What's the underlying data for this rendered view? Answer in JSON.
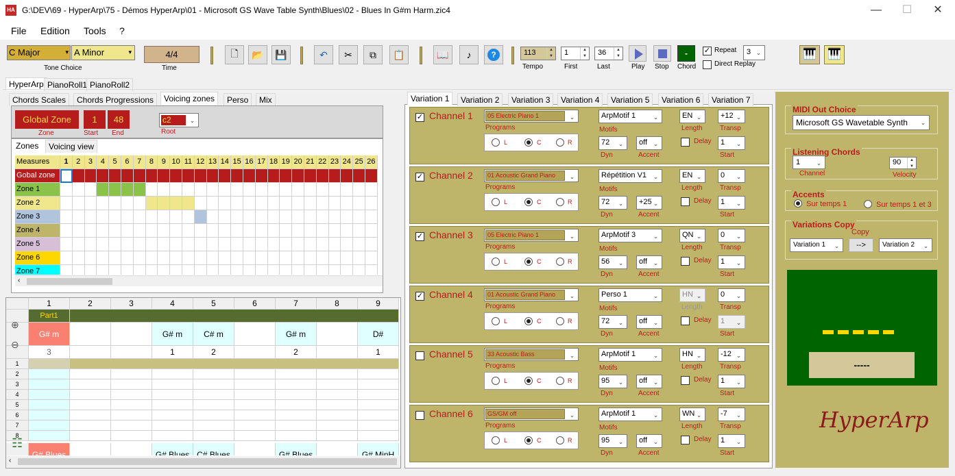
{
  "title": "G:\\DEV\\69 - HyperArp\\75 - Démos HyperArp\\01 - Microsoft GS Wave Table Synth\\Blues\\02 - Blues In G#m Harm.zic4",
  "app_icon_text": "HA",
  "window": {
    "minimize": "—",
    "maximize": "☐",
    "close": "✕"
  },
  "menu": [
    "File",
    "Edition",
    "Tools",
    "?"
  ],
  "toolbar": {
    "tone1": "C Major",
    "tone2": "A Minor",
    "tone_label": "Tone Choice",
    "time": "4/4",
    "time_label": "Time",
    "tempo": "113",
    "tempo_label": "Tempo",
    "first": "1",
    "first_label": "First",
    "last": "36",
    "last_label": "Last",
    "play_label": "Play",
    "stop_label": "Stop",
    "chord": "-",
    "chord_label": "Chord",
    "repeat_label": "Repeat",
    "repeat_value": "3",
    "direct_replay_label": "Direct Replay",
    "help": "?"
  },
  "main_tabs": [
    "HyperArp",
    "PianoRoll1",
    "PianoRoll2"
  ],
  "sub_tabs": [
    "Chords Scales",
    "Chords Progressions",
    "Voicing zones",
    "Perso",
    "Mix"
  ],
  "zone_header": {
    "zone": "Global Zone",
    "zone_label": "Zone",
    "start": "1",
    "start_label": "Start",
    "end": "48",
    "end_label": "End",
    "root": "c2",
    "root_label": "Root"
  },
  "zone_tabs": [
    "Zones",
    "Voicing view"
  ],
  "zones_grid": {
    "header": "Measures",
    "measures": [
      "1",
      "2",
      "3",
      "4",
      "5",
      "6",
      "7",
      "8",
      "9",
      "10",
      "11",
      "12",
      "13",
      "14",
      "15",
      "16",
      "17",
      "18",
      "19",
      "20",
      "21",
      "22",
      "23",
      "24",
      "25",
      "26"
    ],
    "rows": [
      {
        "name": "Gobal zone",
        "color": "#b71c1c",
        "text_color": "#ffffff"
      },
      {
        "name": "Zone  1",
        "color": "#8bc34a",
        "text_color": "#000000"
      },
      {
        "name": "Zone  2",
        "color": "#f0e68c",
        "text_color": "#000000"
      },
      {
        "name": "Zone  3",
        "color": "#b0c4de",
        "text_color": "#000000"
      },
      {
        "name": "Zone  4",
        "color": "#bfb56a",
        "text_color": "#000000"
      },
      {
        "name": "Zone  5",
        "color": "#d8bfd8",
        "text_color": "#000000"
      },
      {
        "name": "Zone  6",
        "color": "#ffd700",
        "text_color": "#000000"
      },
      {
        "name": "Zone  7",
        "color": "#00ffff",
        "text_color": "#000000"
      }
    ]
  },
  "chord_grid": {
    "columns": [
      "1",
      "2",
      "3",
      "4",
      "5",
      "6",
      "7",
      "8",
      "9"
    ],
    "part": "Part1",
    "chords": [
      "G# m",
      "",
      "",
      "G# m",
      "C# m",
      "",
      "G# m",
      "",
      "D#"
    ],
    "degrees": [
      "3",
      "",
      "",
      "1",
      "2",
      "",
      "2",
      "",
      "1"
    ],
    "row_numbers": [
      "1",
      "2",
      "3",
      "4",
      "5",
      "6",
      "7",
      "8"
    ],
    "scales": [
      "G# Blues",
      "",
      "",
      "G# Blues",
      "C# Blues",
      "",
      "G# Blues",
      "",
      "G# MinH"
    ]
  },
  "variation_tabs": [
    "Variation 1",
    "Variation 2",
    "Variation 3",
    "Variation 4",
    "Variation 5",
    "Variation 6",
    "Variation 7"
  ],
  "labels": {
    "programs": "Programs",
    "motifs": "Motifs",
    "length": "Length",
    "transp": "Transp",
    "dyn": "Dyn",
    "accent": "Accent",
    "delay": "Delay",
    "start": "Start",
    "l": "L",
    "c": "C",
    "r": "R"
  },
  "channels": [
    {
      "name": "Channel 1",
      "checked": true,
      "program": "05 Electric Piano 1",
      "motif": "ArpMotif 1",
      "length": "EN",
      "transp": "+12",
      "dyn": "72",
      "accent": "off",
      "start": "1",
      "length_disabled": false
    },
    {
      "name": "Channel 2",
      "checked": true,
      "program": "01 Acoustic Grand Piano",
      "motif": "Répétition V1",
      "length": "EN",
      "transp": "0",
      "dyn": "72",
      "accent": "+25",
      "start": "1",
      "length_disabled": false
    },
    {
      "name": "Channel 3",
      "checked": true,
      "program": "05 Electric Piano 1",
      "motif": "ArpMotif 3",
      "length": "QN",
      "transp": "0",
      "dyn": "56",
      "accent": "off",
      "start": "1",
      "length_disabled": false
    },
    {
      "name": "Channel 4",
      "checked": true,
      "program": "01 Acoustic Grand Piano",
      "motif": "Perso 1",
      "length": "HN",
      "transp": "0",
      "dyn": "72",
      "accent": "off",
      "start": "1",
      "length_disabled": true
    },
    {
      "name": "Channel 5",
      "checked": false,
      "program": "33 Acoustic Bass",
      "motif": "ArpMotif 1",
      "length": "HN",
      "transp": "-12",
      "dyn": "95",
      "accent": "off",
      "start": "1",
      "length_disabled": false
    },
    {
      "name": "Channel 6",
      "checked": false,
      "program": "GS/GM off",
      "motif": "ArpMotif 1",
      "length": "WN",
      "transp": "-7",
      "dyn": "95",
      "accent": "off",
      "start": "1",
      "length_disabled": false
    }
  ],
  "right_panel": {
    "midi_title": "MIDI Out Choice",
    "midi_device": "Microsoft GS Wavetable Synth",
    "listening_title": "Listening Chords",
    "channel": "1",
    "channel_label": "Channel",
    "velocity": "90",
    "velocity_label": "Velocity",
    "accents_title": "Accents",
    "accent1": "Sur temps 1",
    "accent2": "Sur temps 1 et 3",
    "copy_title": "Variations Copy",
    "copy_label": "Copy",
    "copy_from": "Variation 1",
    "copy_btn": "-->",
    "copy_to": "Variation 2",
    "display_value": "-----",
    "logo": "HyperArp"
  }
}
